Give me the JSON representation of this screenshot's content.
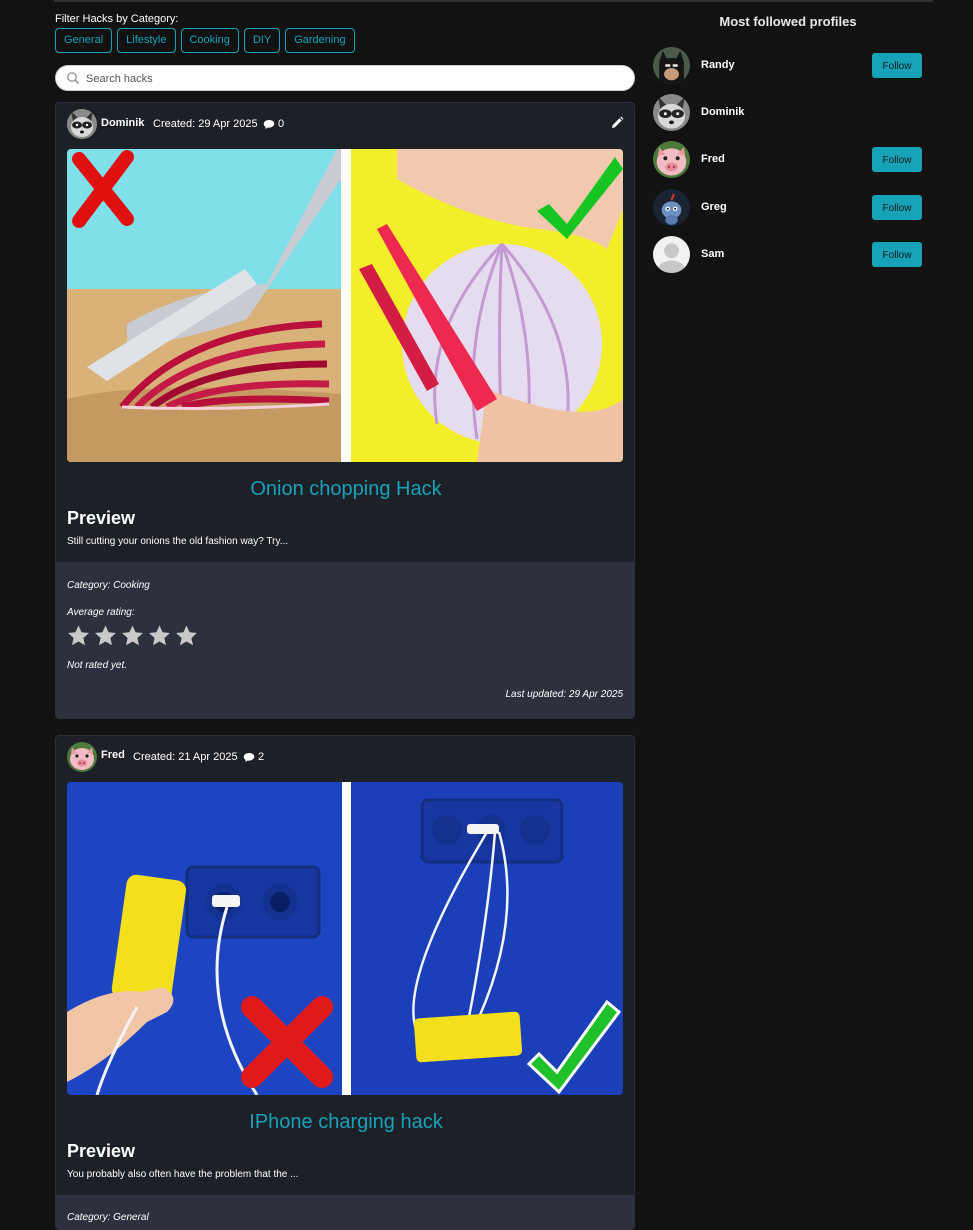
{
  "filter": {
    "label": "Filter Hacks by Category:",
    "categories": [
      "General",
      "Lifestyle",
      "Cooking",
      "DIY",
      "Gardening"
    ]
  },
  "search": {
    "placeholder": "Search hacks",
    "value": ""
  },
  "posts": [
    {
      "author": "Dominik",
      "created": "Created: 29 Apr 2025",
      "comments": "0",
      "title": "Onion chopping Hack",
      "preview_heading": "Preview",
      "preview_text": "Still cutting your onions the old fashion way? Try...",
      "category": "Category: Cooking",
      "rating_label": "Average rating:",
      "rating_value": 0,
      "rating_max": 5,
      "rating_status": "Not rated yet.",
      "last_updated": "Last updated: 29 Apr 2025"
    },
    {
      "author": "Fred",
      "created": "Created: 21 Apr 2025",
      "comments": "2",
      "title": "IPhone charging hack",
      "preview_heading": "Preview",
      "preview_text": "You probably also often have the problem that the ...",
      "category": "Category: General"
    }
  ],
  "sidebar": {
    "title": "Most followed profiles",
    "follow_label": "Follow",
    "profiles": [
      {
        "name": "Randy",
        "followable": true
      },
      {
        "name": "Dominik",
        "followable": false
      },
      {
        "name": "Fred",
        "followable": true
      },
      {
        "name": "Greg",
        "followable": true
      },
      {
        "name": "Sam",
        "followable": true
      }
    ]
  },
  "colors": {
    "accent": "#17a2b8",
    "background": "#121212",
    "card": "#1e2028",
    "card_footer": "#2d303d"
  },
  "icons": [
    "search-icon",
    "comment-icon",
    "pencil-icon",
    "star-icon"
  ]
}
